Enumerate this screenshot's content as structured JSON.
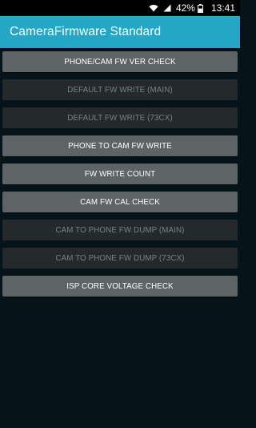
{
  "status_bar": {
    "battery_percent": "42%",
    "time": "13:41",
    "icons": [
      "wifi-icon",
      "signal-icon",
      "battery-icon"
    ]
  },
  "app_bar": {
    "title": "CameraFirmware Standard",
    "color": "#24a7c5"
  },
  "buttons": [
    {
      "label": "PHONE/CAM FW VER CHECK",
      "enabled": true
    },
    {
      "label": "DEFAULT FW WRITE (MAIN)",
      "enabled": false
    },
    {
      "label": "DEFAULT FW WRITE (73CX)",
      "enabled": false
    },
    {
      "label": "PHONE TO CAM FW WRITE",
      "enabled": true
    },
    {
      "label": "FW WRITE COUNT",
      "enabled": true
    },
    {
      "label": "CAM FW CAL CHECK",
      "enabled": true
    },
    {
      "label": "CAM TO PHONE FW DUMP (MAIN)",
      "enabled": false
    },
    {
      "label": "CAM TO PHONE FW DUMP (73CX)",
      "enabled": false
    },
    {
      "label": "ISP CORE VOLTAGE CHECK",
      "enabled": true
    }
  ]
}
